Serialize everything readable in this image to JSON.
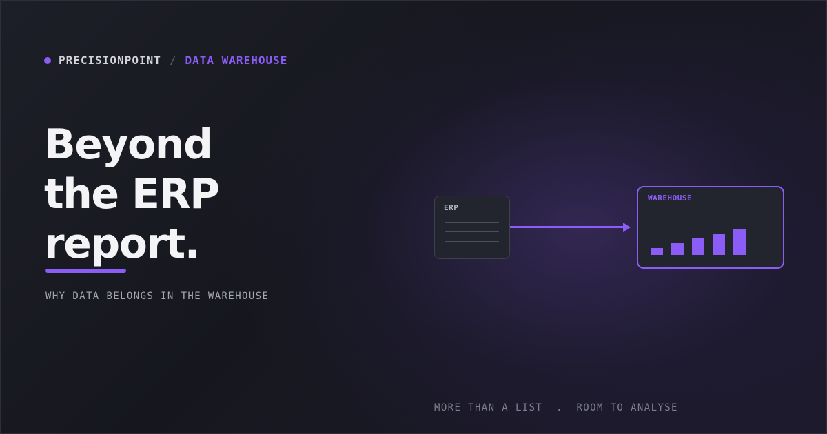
{
  "brand": {
    "company": "PRECISIONPOINT",
    "separator": "/",
    "section": "DATA WAREHOUSE"
  },
  "headline": {
    "lines": [
      "Beyond",
      "the ERP",
      "report."
    ]
  },
  "subtitle": "WHY DATA BELONGS IN THE WAREHOUSE",
  "diagram": {
    "erp_label": "ERP",
    "warehouse_label": "WAREHOUSE",
    "bar_levels": [
      0.25,
      0.45,
      0.62,
      0.8,
      1.0
    ]
  },
  "footer": {
    "item1": "MORE THAN A LIST",
    "divider": ".",
    "item2": "ROOM TO ANALYSE"
  },
  "colors": {
    "accent": "#8b5cf6",
    "background": "#16171e",
    "card": "#23252e",
    "text_primary": "#f4f4f7"
  }
}
